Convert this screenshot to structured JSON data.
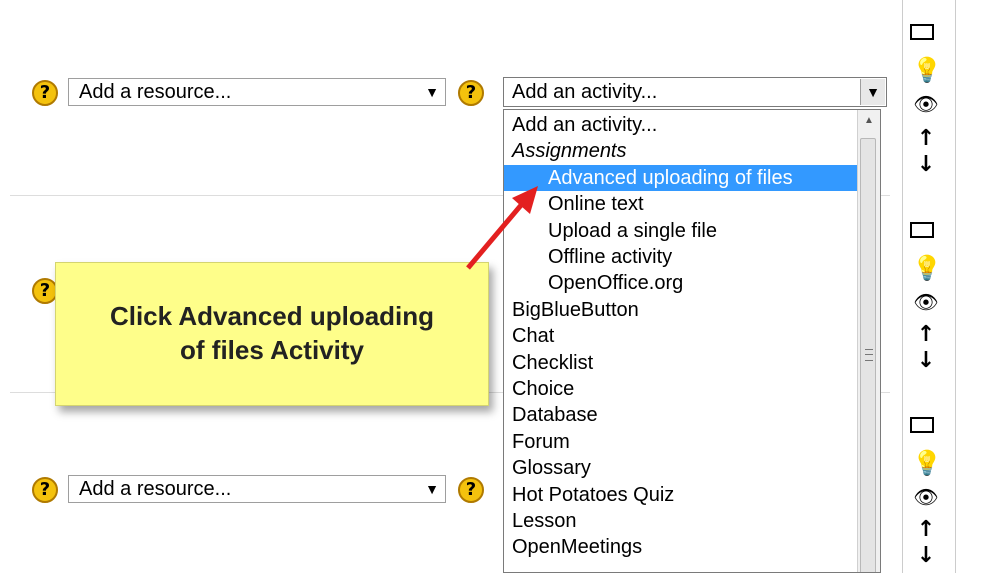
{
  "resource_select_top": {
    "value": "Add a resource..."
  },
  "resource_select_bottom": {
    "value": "Add a resource..."
  },
  "activity_select": {
    "value": "Add an activity..."
  },
  "help_glyph": "?",
  "activity_list": [
    {
      "label": "Add an activity...",
      "type": "option"
    },
    {
      "label": "Assignments",
      "type": "group"
    },
    {
      "label": "Advanced uploading of files",
      "type": "suboption",
      "selected": true
    },
    {
      "label": "Online text",
      "type": "suboption"
    },
    {
      "label": "Upload a single file",
      "type": "suboption"
    },
    {
      "label": "Offline activity",
      "type": "suboption"
    },
    {
      "label": "OpenOffice.org",
      "type": "suboption"
    },
    {
      "label": "BigBlueButton",
      "type": "option"
    },
    {
      "label": "Chat",
      "type": "option"
    },
    {
      "label": "Checklist",
      "type": "option"
    },
    {
      "label": "Choice",
      "type": "option"
    },
    {
      "label": "Database",
      "type": "option"
    },
    {
      "label": "Forum",
      "type": "option"
    },
    {
      "label": "Glossary",
      "type": "option"
    },
    {
      "label": "Hot Potatoes Quiz",
      "type": "option"
    },
    {
      "label": "Lesson",
      "type": "option"
    },
    {
      "label": "OpenMeetings",
      "type": "option"
    }
  ],
  "callout": {
    "line1": "Click Advanced uploading",
    "line2": "of files Activity",
    "background": "#fefe8a",
    "arrow_color": "#e32020"
  },
  "icons": {
    "highlight": "lightbulb-icon",
    "visibility": "eye-icon",
    "move": "move-updown-icon",
    "box": "checkbox-icon"
  },
  "colors": {
    "selection": "#3399ff",
    "help_icon": "#f4c20d"
  }
}
